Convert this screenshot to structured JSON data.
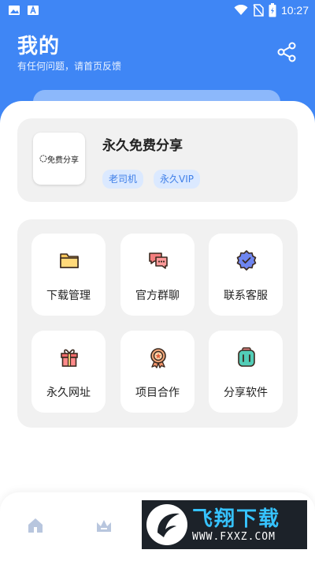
{
  "status_bar": {
    "time": "10:27"
  },
  "header": {
    "title": "我的",
    "subtitle": "有任何问题，请首页反馈"
  },
  "profile": {
    "avatar_text": "免费分享",
    "name": "永久免费分享",
    "tags": [
      "老司机",
      "永久VIP"
    ]
  },
  "menu": [
    {
      "label": "下载管理",
      "icon": "folder-icon"
    },
    {
      "label": "官方群聊",
      "icon": "chat-icon"
    },
    {
      "label": "联系客服",
      "icon": "service-badge-icon"
    },
    {
      "label": "永久网址",
      "icon": "gift-icon"
    },
    {
      "label": "项目合作",
      "icon": "medal-icon"
    },
    {
      "label": "分享软件",
      "icon": "share-app-icon"
    }
  ],
  "bottom_nav": [
    {
      "icon": "home-icon"
    },
    {
      "icon": "crown-icon"
    }
  ],
  "watermark": {
    "title": "飞翔下载",
    "url": "WWW.FXXZ.COM"
  },
  "colors": {
    "primary": "#3f86f5",
    "tag_bg": "#dbe9ff",
    "tag_text": "#3f7fe8",
    "card_bg": "#f1f1f1"
  }
}
